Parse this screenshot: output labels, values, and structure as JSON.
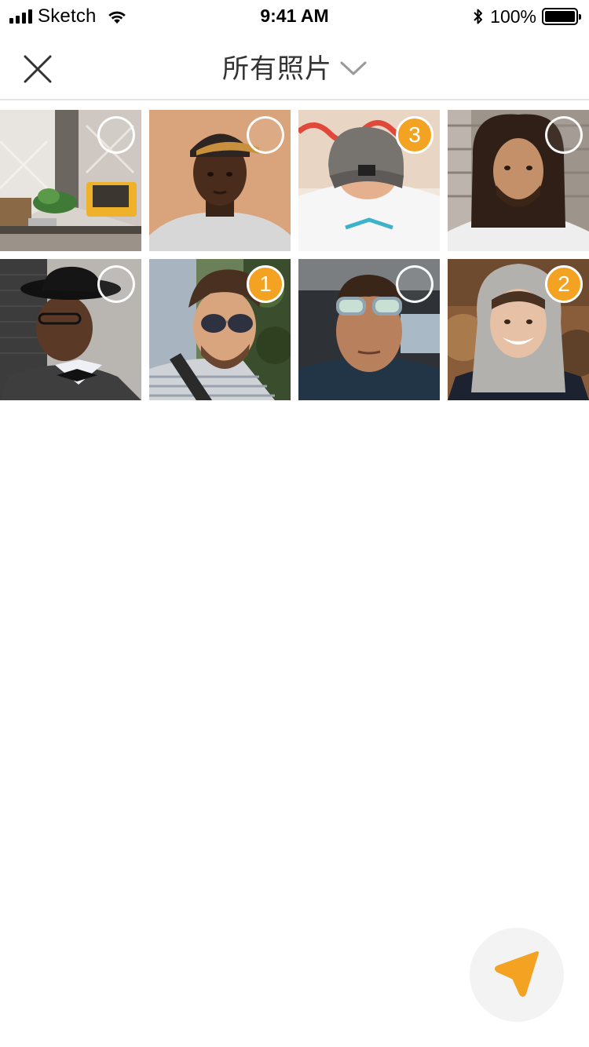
{
  "status_bar": {
    "carrier": "Sketch",
    "time": "9:41 AM",
    "battery_percent": "100%",
    "signal_icon": "signal-bars-icon",
    "wifi_icon": "wifi-icon",
    "bluetooth_icon": "bluetooth-icon",
    "battery_icon": "battery-icon"
  },
  "nav": {
    "title": "所有照片",
    "close_icon": "close-icon",
    "dropdown_icon": "chevron-down-icon"
  },
  "grid": {
    "photos": [
      {
        "subject": "interior-room",
        "selected": false,
        "order": ""
      },
      {
        "subject": "man-tan-cap",
        "selected": false,
        "order": ""
      },
      {
        "subject": "man-grey-cap-welcome",
        "selected": true,
        "order": "3"
      },
      {
        "subject": "man-dreadlocks",
        "selected": false,
        "order": ""
      },
      {
        "subject": "man-black-hat-bowtie",
        "selected": false,
        "order": ""
      },
      {
        "subject": "man-aviator-sunglasses",
        "selected": true,
        "order": "1"
      },
      {
        "subject": "man-mirrored-sunglasses-car",
        "selected": false,
        "order": ""
      },
      {
        "subject": "woman-grey-hoodie",
        "selected": true,
        "order": "2"
      }
    ]
  },
  "send_button": {
    "icon": "send-icon"
  },
  "colors": {
    "accent": "#f3a321",
    "divider": "#e6e6e6",
    "fab_background": "#f3f3f3"
  }
}
